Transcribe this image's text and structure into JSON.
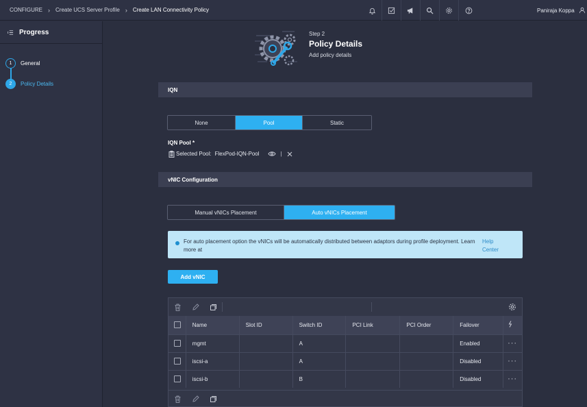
{
  "breadcrumb": {
    "items": [
      "CONFIGURE",
      "Create UCS Server Profile",
      "Create LAN Connectivity Policy"
    ]
  },
  "topbar": {
    "icons": [
      "bell-icon",
      "checklist-icon",
      "megaphone-icon",
      "search-icon",
      "gear-icon",
      "help-icon"
    ],
    "user_name": "Paniraja Koppa"
  },
  "sidebar": {
    "title": "Progress",
    "steps": [
      {
        "number": "1",
        "label": "General",
        "state": "done"
      },
      {
        "number": "2",
        "label": "Policy Details",
        "state": "active"
      }
    ]
  },
  "header": {
    "step": "Step 2",
    "title": "Policy Details",
    "subtitle": "Add policy details"
  },
  "iqn": {
    "section_title": "IQN",
    "options": [
      "None",
      "Pool",
      "Static"
    ],
    "selected": "Pool",
    "pool_label": "IQN Pool *",
    "selected_pool_label": "Selected Pool:",
    "selected_pool_value": "FlexPod-IQN-Pool",
    "separator": "|"
  },
  "vnic": {
    "section_title": "vNIC Configuration",
    "placement_options": [
      "Manual vNICs Placement",
      "Auto vNICs Placement"
    ],
    "selected": "Auto vNICs Placement",
    "info_text": "For auto placement option the vNICs will be automatically distributed between adaptors during profile deployment. Learn more at",
    "info_link": "Help Center",
    "add_button": "Add vNIC",
    "table": {
      "columns": [
        "Name",
        "Slot ID",
        "Switch ID",
        "PCI Link",
        "PCI Order",
        "Failover"
      ],
      "rows": [
        {
          "name": "mgmt",
          "slot_id": "",
          "switch_id": "A",
          "pci_link": "",
          "pci_order": "",
          "failover": "Enabled"
        },
        {
          "name": "iscsi-a",
          "slot_id": "",
          "switch_id": "A",
          "pci_link": "",
          "pci_order": "",
          "failover": "Disabled"
        },
        {
          "name": "iscsi-b",
          "slot_id": "",
          "switch_id": "B",
          "pci_link": "",
          "pci_order": "",
          "failover": "Disabled"
        }
      ],
      "row_menu": "···"
    }
  },
  "colors": {
    "accent": "#2eb0f1",
    "background": "#2b2f3f",
    "panel": "#2e3244",
    "info_bg": "#bfe6f8"
  }
}
